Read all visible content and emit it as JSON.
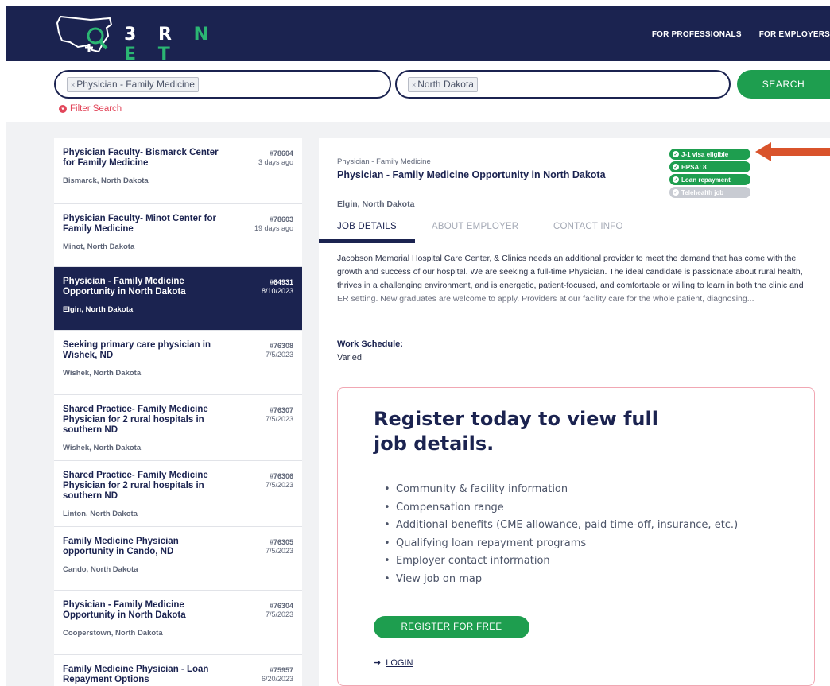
{
  "header": {
    "logo_prefix": "3 R ",
    "logo_suffix": "N E T",
    "nav": [
      "FOR PROFESSIONALS",
      "FOR EMPLOYERS"
    ]
  },
  "search": {
    "specialty_tag": "Physician - Family Medicine",
    "location_tag": "North Dakota",
    "remove_glyph": "×",
    "button_label": "SEARCH",
    "filter_label": "Filter Search"
  },
  "listings": [
    {
      "title": "Physician Faculty- Bismarck Center for Family Medicine",
      "id": "#78604",
      "date": "3 days ago",
      "location": "Bismarck, North Dakota"
    },
    {
      "title": "Physician Faculty- Minot Center for Family Medicine",
      "id": "#78603",
      "date": "19 days ago",
      "location": "Minot, North Dakota"
    },
    {
      "title": "Physician - Family Medicine Opportunity in North Dakota",
      "id": "#64931",
      "date": "8/10/2023",
      "location": "Elgin, North Dakota"
    },
    {
      "title": "Seeking primary care physician in Wishek, ND",
      "id": "#76308",
      "date": "7/5/2023",
      "location": "Wishek, North Dakota"
    },
    {
      "title": "Shared Practice- Family Medicine Physician for 2 rural hospitals in southern ND",
      "id": "#76307",
      "date": "7/5/2023",
      "location": "Wishek, North Dakota"
    },
    {
      "title": "Shared Practice- Family Medicine Physician for 2 rural hospitals in southern ND",
      "id": "#76306",
      "date": "7/5/2023",
      "location": "Linton, North Dakota"
    },
    {
      "title": "Family Medicine Physician opportunity in Cando, ND",
      "id": "#76305",
      "date": "7/5/2023",
      "location": "Cando, North Dakota"
    },
    {
      "title": "Physician - Family Medicine Opportunity in North Dakota",
      "id": "#76304",
      "date": "7/5/2023",
      "location": "Cooperstown, North Dakota"
    },
    {
      "title": "Family Medicine Physician - Loan Repayment Options",
      "id": "#75957",
      "date": "6/20/2023",
      "location": ""
    }
  ],
  "detail": {
    "category": "Physician - Family Medicine",
    "title": "Physician - Family Medicine Opportunity in North Dakota",
    "location": "Elgin, North Dakota",
    "badges": [
      {
        "label": "J-1 visa eligible",
        "state": "on"
      },
      {
        "label": "HPSA: 8",
        "state": "on"
      },
      {
        "label": "Loan repayment",
        "state": "on"
      },
      {
        "label": "Telehealth job",
        "state": "off"
      }
    ],
    "tabs": [
      "JOB DETAILS",
      "ABOUT EMPLOYER",
      "CONTACT INFO"
    ],
    "description": "Jacobson Memorial Hospital Care Center, & Clinics needs an additional provider to meet the demand that has come with the growth and success of our hospital. We are seeking a full-time Physician. The ideal candidate is passionate about rural health, thrives in a challenging environment, and is energetic, patient-focused, and comfortable or willing to learn in both the clinic and ER setting. New graduates are welcome to apply. Providers at our facility care for the whole patient, diagnosing...",
    "work_schedule_label": "Work Schedule:",
    "work_schedule_value": "Varied"
  },
  "register": {
    "title": "Register today to view full job details.",
    "items": [
      "Community & facility information",
      "Compensation range",
      "Additional benefits (CME allowance, paid time-off, insurance, etc.)",
      "Qualifying loan repayment programs",
      "Employer contact information",
      "View job on map"
    ],
    "button_label": "REGISTER FOR FREE",
    "login_label": "LOGIN"
  },
  "colors": {
    "navy": "#1b2350",
    "green": "#1e9e4f",
    "red_accent": "#e2465a",
    "arrow": "#d9532b"
  },
  "icons": [
    "usa-map-logo-icon",
    "remove-tag-icon",
    "filter-icon",
    "check-circle-icon",
    "login-arrow-icon",
    "red-arrow-pointer-icon"
  ]
}
